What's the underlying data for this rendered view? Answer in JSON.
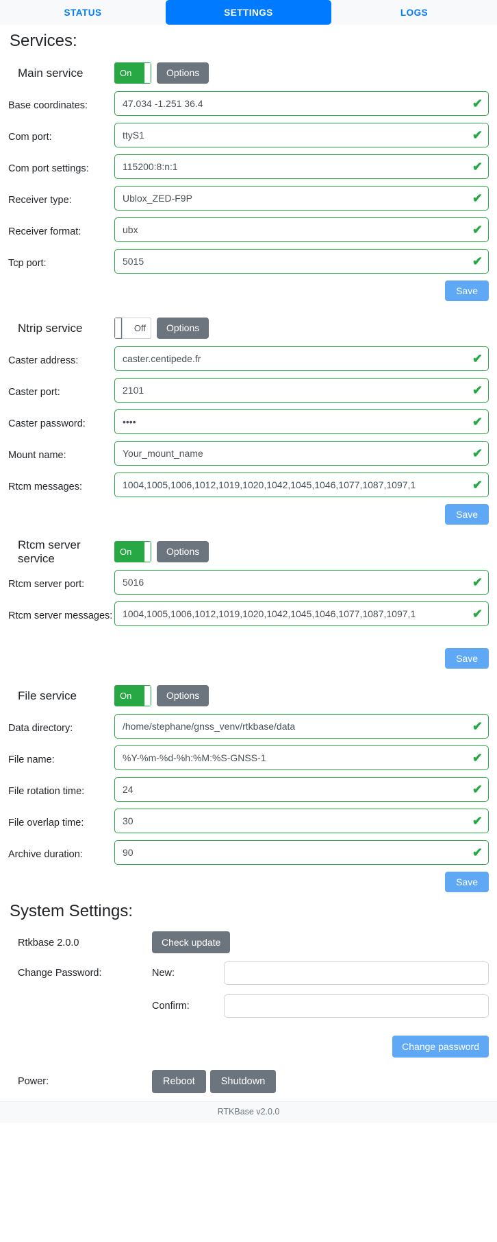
{
  "tabs": [
    {
      "label": "STATUS",
      "active": false
    },
    {
      "label": "SETTINGS",
      "active": true
    },
    {
      "label": "LOGS",
      "active": false
    }
  ],
  "services_heading": "Services:",
  "system_heading": "System Settings:",
  "common": {
    "on_label": "On",
    "off_label": "Off",
    "options_label": "Options",
    "save_label": "Save",
    "check_mark": "✔"
  },
  "main_service": {
    "name": "Main service",
    "toggle_state": "On",
    "options_label": "Options",
    "save_label": "Save",
    "fields": [
      {
        "label": "Base coordinates:",
        "value": "47.034 -1.251 36.4"
      },
      {
        "label": "Com port:",
        "value": "ttyS1"
      },
      {
        "label": "Com port settings:",
        "value": "115200:8:n:1"
      },
      {
        "label": "Receiver type:",
        "value": "Ublox_ZED-F9P"
      },
      {
        "label": "Receiver format:",
        "value": "ubx"
      },
      {
        "label": "Tcp port:",
        "value": "5015"
      }
    ]
  },
  "ntrip_service": {
    "name": "Ntrip service",
    "toggle_state": "Off",
    "options_label": "Options",
    "save_label": "Save",
    "fields": [
      {
        "label": "Caster address:",
        "value": "caster.centipede.fr"
      },
      {
        "label": "Caster port:",
        "value": "2101"
      },
      {
        "label": "Caster password:",
        "value": "••••"
      },
      {
        "label": "Mount name:",
        "value": "Your_mount_name"
      },
      {
        "label": "Rtcm messages:",
        "value": "1004,1005,1006,1012,1019,1020,1042,1045,1046,1077,1087,1097,1"
      }
    ]
  },
  "rtcm_server_service": {
    "name": "Rtcm server service",
    "toggle_state": "On",
    "options_label": "Options",
    "save_label": "Save",
    "fields": [
      {
        "label": "Rtcm server port:",
        "value": "5016"
      },
      {
        "label": "Rtcm server messages:",
        "value": "1004,1005,1006,1012,1019,1020,1042,1045,1046,1077,1087,1097,1"
      }
    ]
  },
  "file_service": {
    "name": "File service",
    "toggle_state": "On",
    "options_label": "Options",
    "save_label": "Save",
    "fields": [
      {
        "label": "Data directory:",
        "value": "/home/stephane/gnss_venv/rtkbase/data"
      },
      {
        "label": "File name:",
        "value": "%Y-%m-%d-%h:%M:%S-GNSS-1"
      },
      {
        "label": "File rotation time:",
        "value": "24"
      },
      {
        "label": "File overlap time:",
        "value": "30"
      },
      {
        "label": "Archive duration:",
        "value": "90"
      }
    ]
  },
  "system": {
    "version_label": "Rtkbase 2.0.0",
    "check_update_label": "Check update",
    "change_password_label": "Change Password:",
    "new_label": "New:",
    "new_value": "",
    "confirm_label": "Confirm:",
    "confirm_value": "",
    "change_password_button": "Change password",
    "power_label": "Power:",
    "reboot_label": "Reboot",
    "shutdown_label": "Shutdown"
  },
  "footer": {
    "text": "RTKBase v2.0.0"
  },
  "colors": {
    "accent_blue": "#007bff",
    "button_blue": "#5fa8f5",
    "toggle_on_green": "#28a745",
    "toggle_off_grey": "#6c757d",
    "valid_green": "#28a745",
    "grey_button": "#6c757d"
  }
}
